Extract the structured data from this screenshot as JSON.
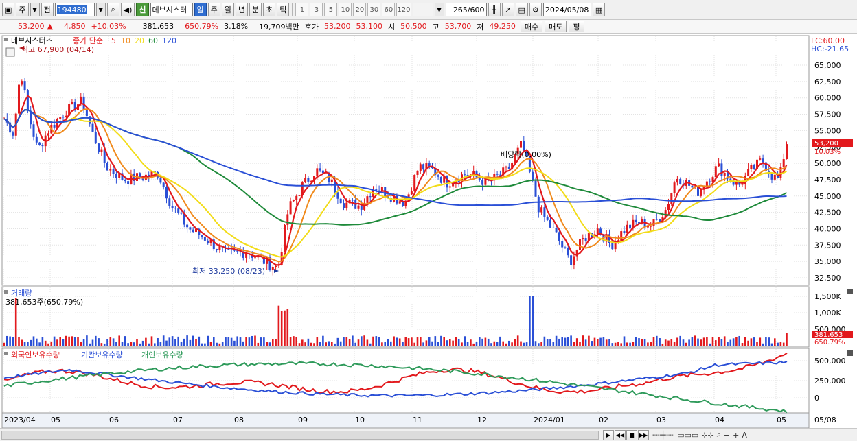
{
  "toolbar": {
    "market_label": "주",
    "prev_label": "전",
    "code_value": "194480",
    "stock_tag": "신",
    "stock_name": "데브시스터",
    "period_tabs": [
      "일",
      "주",
      "월",
      "년",
      "분",
      "초",
      "틱"
    ],
    "selected_period": "일",
    "interval_buttons": [
      "1",
      "3",
      "5",
      "10",
      "20",
      "30",
      "60",
      "120"
    ],
    "count_value": "265",
    "count_max": "/600",
    "date_value": "2024/05/08"
  },
  "quote": {
    "price": "53,200",
    "change": "4,850",
    "change_pct": "+10.03%",
    "volume": "381,653",
    "volume_ratio": "650.79%",
    "turnover": "3.18%",
    "amount": "19,709백만",
    "bid_label": "호가",
    "ask_price": "53,200",
    "bid_price": "53,100",
    "open_label": "시",
    "open": "50,500",
    "high_label": "고",
    "high": "53,700",
    "low_label": "저",
    "low": "49,250",
    "buy_label": "매수",
    "sell_label": "매도",
    "avg_label": "평"
  },
  "price_panel": {
    "title": "데브시스터즈",
    "ma_title": "종가 단순",
    "ma_periods": [
      {
        "label": "5",
        "color": "#e2191d"
      },
      {
        "label": "10",
        "color": "#f08a1c"
      },
      {
        "label": "20",
        "color": "#f2dc18"
      },
      {
        "label": "60",
        "color": "#1e8a3a"
      },
      {
        "label": "120",
        "color": "#2a4fd6"
      }
    ],
    "lc": "LC:60.00",
    "hc": "HC:-21.65",
    "high_marker": "최고 67,900 (04/14)",
    "low_marker": "최저 33,250 (08/23)",
    "dividend_marker": "배당락(0.00%)",
    "price_tag": "53,200",
    "pct_tag": "10.03%",
    "y_ticks": [
      "65,000",
      "62,500",
      "60,000",
      "57,500",
      "55,000",
      "52,500",
      "50,000",
      "47,500",
      "45,000",
      "42,500",
      "40,000",
      "37,500",
      "35,000",
      "32,500"
    ]
  },
  "volume_panel": {
    "title": "거래량",
    "subtitle": "381,653주(650.79%)",
    "y_ticks": [
      "1,500K",
      "1,000K",
      "500,000"
    ],
    "value_tag": "381,653",
    "pct_tag": "650.79%"
  },
  "holding_panel": {
    "series": [
      {
        "label": "외국인보유수량",
        "color": "#e2191d"
      },
      {
        "label": "기관보유수량",
        "color": "#2a4fd6"
      },
      {
        "label": "개인보유수량",
        "color": "#2e9a5a"
      }
    ],
    "y_ticks": [
      "500,000",
      "250,000",
      "0"
    ]
  },
  "x_axis": [
    "2023/04",
    "05",
    "06",
    "07",
    "08",
    "09",
    "10",
    "11",
    "12",
    "2024/01",
    "02",
    "03",
    "04",
    "05",
    "05/08"
  ],
  "colors": {
    "up": "#e2191d",
    "down": "#2a4fd6",
    "grid": "#d8d8d8"
  }
}
